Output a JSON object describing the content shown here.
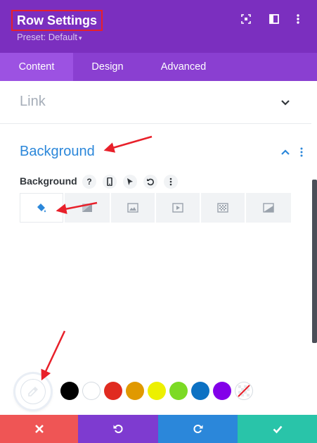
{
  "header": {
    "title": "Row Settings",
    "preset": "Preset: Default",
    "icons": [
      "fullscreen-icon",
      "sidebar-icon",
      "more-icon"
    ]
  },
  "tabs": [
    {
      "label": "Content",
      "active": true
    },
    {
      "label": "Design",
      "active": false
    },
    {
      "label": "Advanced",
      "active": false
    }
  ],
  "link_section": {
    "title": "Link",
    "state": "collapsed"
  },
  "background_section": {
    "title": "Background",
    "state": "expanded",
    "field_label": "Background",
    "field_icons": [
      "help-icon",
      "mobile-icon",
      "cursor-icon",
      "reset-icon",
      "more-icon"
    ],
    "help_glyph": "?",
    "type_tabs": [
      "color-tab",
      "gradient-tab",
      "image-tab",
      "video-tab",
      "pattern-tab",
      "mask-tab"
    ],
    "active_type": "color-tab"
  },
  "swatches": {
    "colors": [
      "#000000",
      "#ffffff",
      "#e02b20",
      "#e09900",
      "#edf000",
      "#7cda24",
      "#0c71c3",
      "#8300e9"
    ],
    "clear": "no-color"
  },
  "footer": {
    "buttons": [
      "cancel",
      "undo",
      "redo",
      "save"
    ],
    "colors": {
      "cancel": "#ef5555",
      "undo": "#7e3bd0",
      "redo": "#2b87da",
      "save": "#29c4a9"
    }
  },
  "colors": {
    "header_bg": "#7b2fbf",
    "tabs_bg": "#8a3fd1",
    "active_tab_bg": "#9c52e2",
    "accent": "#2b87da",
    "annotation": "#e8202a"
  }
}
